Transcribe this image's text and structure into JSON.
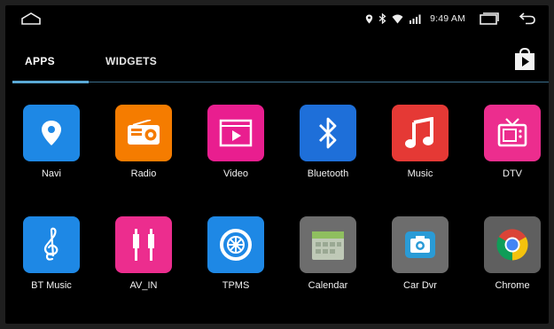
{
  "status": {
    "time": "9:49 AM",
    "icons": [
      "location-icon",
      "bluetooth-icon",
      "wifi-icon",
      "signal-icon"
    ]
  },
  "tabs": [
    {
      "label": "APPS",
      "active": true
    },
    {
      "label": "WIDGETS",
      "active": false
    }
  ],
  "apps": [
    {
      "label": "Navi",
      "icon": "location-pin-icon",
      "color": "#1e88e5"
    },
    {
      "label": "Radio",
      "icon": "radio-icon",
      "color": "#f57c00"
    },
    {
      "label": "Video",
      "icon": "video-icon",
      "color": "#e91e8f"
    },
    {
      "label": "Bluetooth",
      "icon": "bluetooth-icon",
      "color": "#1e6fd9"
    },
    {
      "label": "Music",
      "icon": "music-note-icon",
      "color": "#e53935"
    },
    {
      "label": "DTV",
      "icon": "tv-icon",
      "color": "#ec2d8e"
    },
    {
      "label": "BT Music",
      "icon": "treble-clef-icon",
      "color": "#1e88e5"
    },
    {
      "label": "AV_IN",
      "icon": "rca-plugs-icon",
      "color": "#ec2d8e"
    },
    {
      "label": "TPMS",
      "icon": "tire-icon",
      "color": "#1e88e5"
    },
    {
      "label": "Calendar",
      "icon": "calendar-icon",
      "color": "#6d6d6d"
    },
    {
      "label": "Car Dvr",
      "icon": "camera-icon",
      "color": "#6d6d6d"
    },
    {
      "label": "Chrome",
      "icon": "chrome-icon",
      "color": "#5f5f5f"
    }
  ]
}
